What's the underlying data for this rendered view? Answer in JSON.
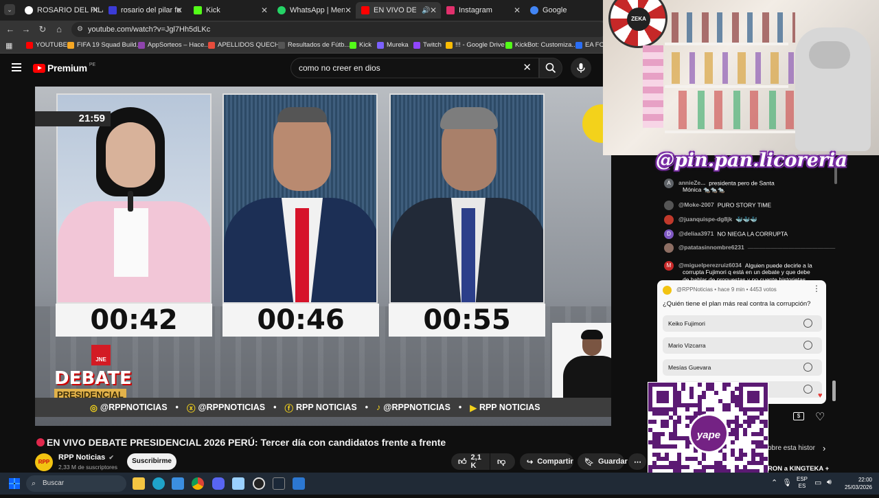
{
  "browser": {
    "tabs": [
      {
        "label": "ROSARIO DEL PILAR",
        "color": "#ffffff"
      },
      {
        "label": "rosario del pilar fernan",
        "color": "#3b3bd6"
      },
      {
        "label": "Kick",
        "color": "#53fc18"
      },
      {
        "label": "WhatsApp | Mensajer",
        "color": "#25d366"
      },
      {
        "label": "EN VIVO DEBA",
        "color": "#ff0000"
      },
      {
        "label": "Instagram",
        "color": "#e1306c"
      },
      {
        "label": "Google",
        "color": "#4285f4"
      }
    ],
    "url": "youtube.com/watch?v=Jgl7Hh5dLKc",
    "bookmarks": [
      {
        "label": "YOUTUBE",
        "color": "#ff0000"
      },
      {
        "label": "FIFA 19 Squad Build...",
        "color": "#f5a623"
      },
      {
        "label": "AppSorteos – Hace...",
        "color": "#8e44ad"
      },
      {
        "label": "APELLIDOS QUECH...",
        "color": "#e74c3c"
      },
      {
        "label": "Resultados de Fútb...",
        "color": "#555555"
      },
      {
        "label": "Kick",
        "color": "#53fc18"
      },
      {
        "label": "Mureka",
        "color": "#7b61ff"
      },
      {
        "label": "Twitch",
        "color": "#9146ff"
      },
      {
        "label": "!!! - Google Drive",
        "color": "#fbbc04"
      },
      {
        "label": "KickBot: Customiza...",
        "color": "#53fc18"
      },
      {
        "label": "EA FC",
        "color": "#2a6ef5"
      }
    ]
  },
  "youtube": {
    "logo": "Premium",
    "logo_region": "PE",
    "search_value": "como no creer en dios",
    "video": {
      "clock": "21:59",
      "timers": [
        "00:42",
        "00:46",
        "00:55"
      ],
      "jne": "JNE",
      "debate_line1": "DEBATE",
      "debate_line2": "PRESIDENCIAL",
      "ticker": [
        "@RPPNOTICIAS",
        "@RPPNOTICIAS",
        "RPP NOTICIAS",
        "@RPPNOTICIAS",
        "RPP NOTICIAS"
      ]
    },
    "title": "EN VIVO DEBATE PRESIDENCIAL 2026 PERÚ: Tercer día con candidatos frente a frente",
    "channel": {
      "avatar": "RPP",
      "name": "RPP Noticias",
      "subscribers": "2,33 M de suscriptores",
      "subscribe_label": "Suscribirme"
    },
    "actions": {
      "likes": "2,1 K",
      "share": "Compartir",
      "save": "Guardar"
    }
  },
  "overlay": {
    "brand": "@pin.pan.licoreria",
    "wheel_text": "ZEKA",
    "qr_label": "yape"
  },
  "chat": {
    "messages": [
      {
        "author": "annieZe...",
        "text": "presidenta pero de Santa",
        "text2": "Mónica 🐀🐀🐀",
        "avatar": "A",
        "color": "#5f6368"
      },
      {
        "author": "@Moke-2007",
        "text": "PURO STORY TIME",
        "avatar": "",
        "color": "#555555"
      },
      {
        "author": "@juanquispe-dg8jk",
        "text": "🐳🐳🐳",
        "avatar": "",
        "color": "#c0392b"
      },
      {
        "author": "@deliaa3971",
        "text": "NO NIEGA LA CORRUPTA",
        "avatar": "D",
        "color": "#7e57c2"
      },
      {
        "author": "@patatasinnombre6231",
        "text": "———————————————",
        "avatar": "",
        "color": "#8d6e63"
      },
      {
        "author": "@miguelperezruiz6034",
        "text": "Alguien puede decirle a la",
        "text2": "corrupta Fujimori q está en un debate y que debe",
        "text3": "de hablar de propuestas y no cuente historietas",
        "avatar": "M",
        "color": "#c62828"
      }
    ],
    "poll": {
      "meta": "@RPPNoticias • hace 9 min • 4453 votos",
      "question": "¿Quién tiene el plan más real contra la corrupción?",
      "options": [
        "Keiko Fujimori",
        "Mario Vizcarra",
        "Mesías Guevara",
        ""
      ]
    },
    "ticker_right": "obre esta histor",
    "ticker_right2": "RON a KINGTEKA +"
  },
  "taskbar": {
    "search": "Buscar",
    "lang": "ESP",
    "lang2": "ES",
    "time": "22:00",
    "date": "25/03/2026"
  }
}
